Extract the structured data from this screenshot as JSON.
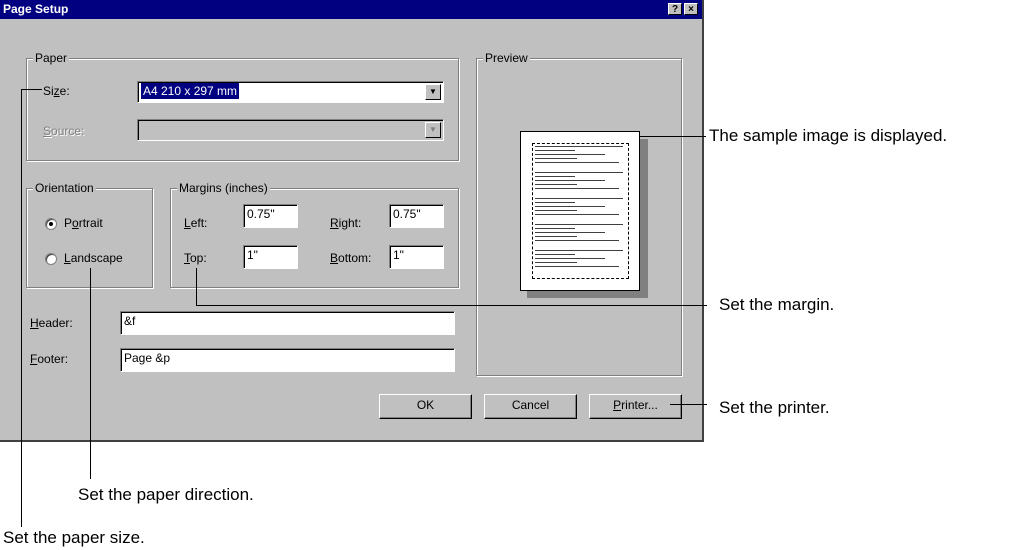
{
  "dialog": {
    "title": "Page Setup",
    "help_glyph": "?",
    "close_glyph": "×"
  },
  "paper": {
    "legend": "Paper",
    "size_label": "Size:",
    "size_value": "A4 210 x 297 mm",
    "source_label": "Source:",
    "source_value": ""
  },
  "orientation": {
    "legend": "Orientation",
    "portrait_label": "Portrait",
    "landscape_label": "Landscape",
    "selected": "Portrait"
  },
  "margins": {
    "legend": "Margins (inches)",
    "left_label": "Left:",
    "left_value": "0.75\"",
    "right_label": "Right:",
    "right_value": "0.75\"",
    "top_label": "Top:",
    "top_value": "1\"",
    "bottom_label": "Bottom:",
    "bottom_value": "1\""
  },
  "header": {
    "label": "Header:",
    "value": "&f"
  },
  "footer": {
    "label": "Footer:",
    "value": "Page &p"
  },
  "preview": {
    "legend": "Preview"
  },
  "buttons": {
    "ok": "OK",
    "cancel": "Cancel",
    "printer": "Printer..."
  },
  "callouts": {
    "sample_image": "The sample image is displayed.",
    "margin": "Set the margin.",
    "printer": "Set the printer.",
    "paper_direction": "Set the paper direction.",
    "paper_size": "Set the paper size."
  },
  "icons": {
    "dropdown": "chevron-down-icon",
    "help": "help-icon",
    "close": "close-icon"
  }
}
